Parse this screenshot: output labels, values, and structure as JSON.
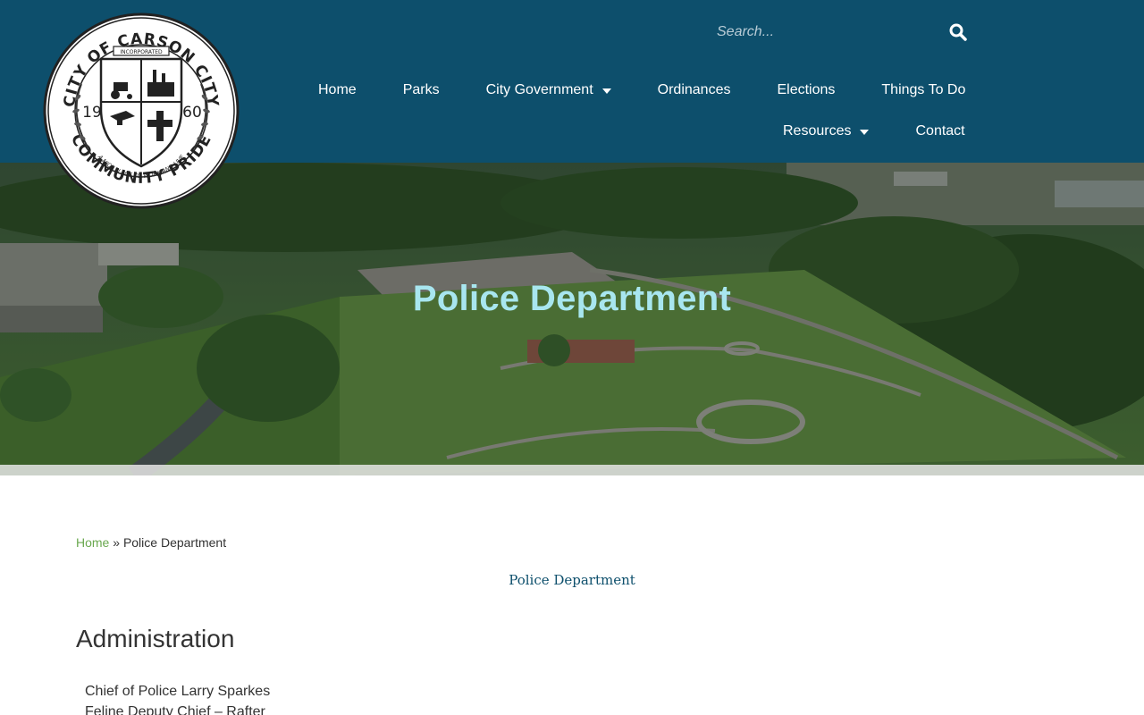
{
  "logo": {
    "top_text": "CITY OF CARSON CITY",
    "bottom_text": "COMMUNITY PRIDE",
    "motto": "A NICE PLACE TO WORK AND LIVE",
    "ribbon": "INCORPORATED",
    "year_left": "19",
    "year_right": "60"
  },
  "search": {
    "placeholder": "Search..."
  },
  "nav": {
    "row1": [
      {
        "label": "Home"
      },
      {
        "label": "Parks"
      },
      {
        "label": "City Government",
        "dropdown": true
      },
      {
        "label": "Ordinances"
      },
      {
        "label": "Elections"
      },
      {
        "label": "Things To Do"
      }
    ],
    "row2": [
      {
        "label": "Resources",
        "dropdown": true
      },
      {
        "label": "Contact"
      }
    ]
  },
  "hero": {
    "title": "Police Department"
  },
  "breadcrumb": {
    "home": "Home",
    "separator": " » ",
    "current": "Police Department"
  },
  "content": {
    "subtitle": "Police Department",
    "section_heading": "Administration",
    "staff": [
      "Chief of Police Larry Sparkes",
      "Feline Deputy Chief – Rafter"
    ]
  },
  "colors": {
    "header_bg": "#0d4f6c",
    "hero_title": "#a8e6ef",
    "breadcrumb_link": "#6aa84f",
    "subtitle": "#0d4f6c"
  }
}
